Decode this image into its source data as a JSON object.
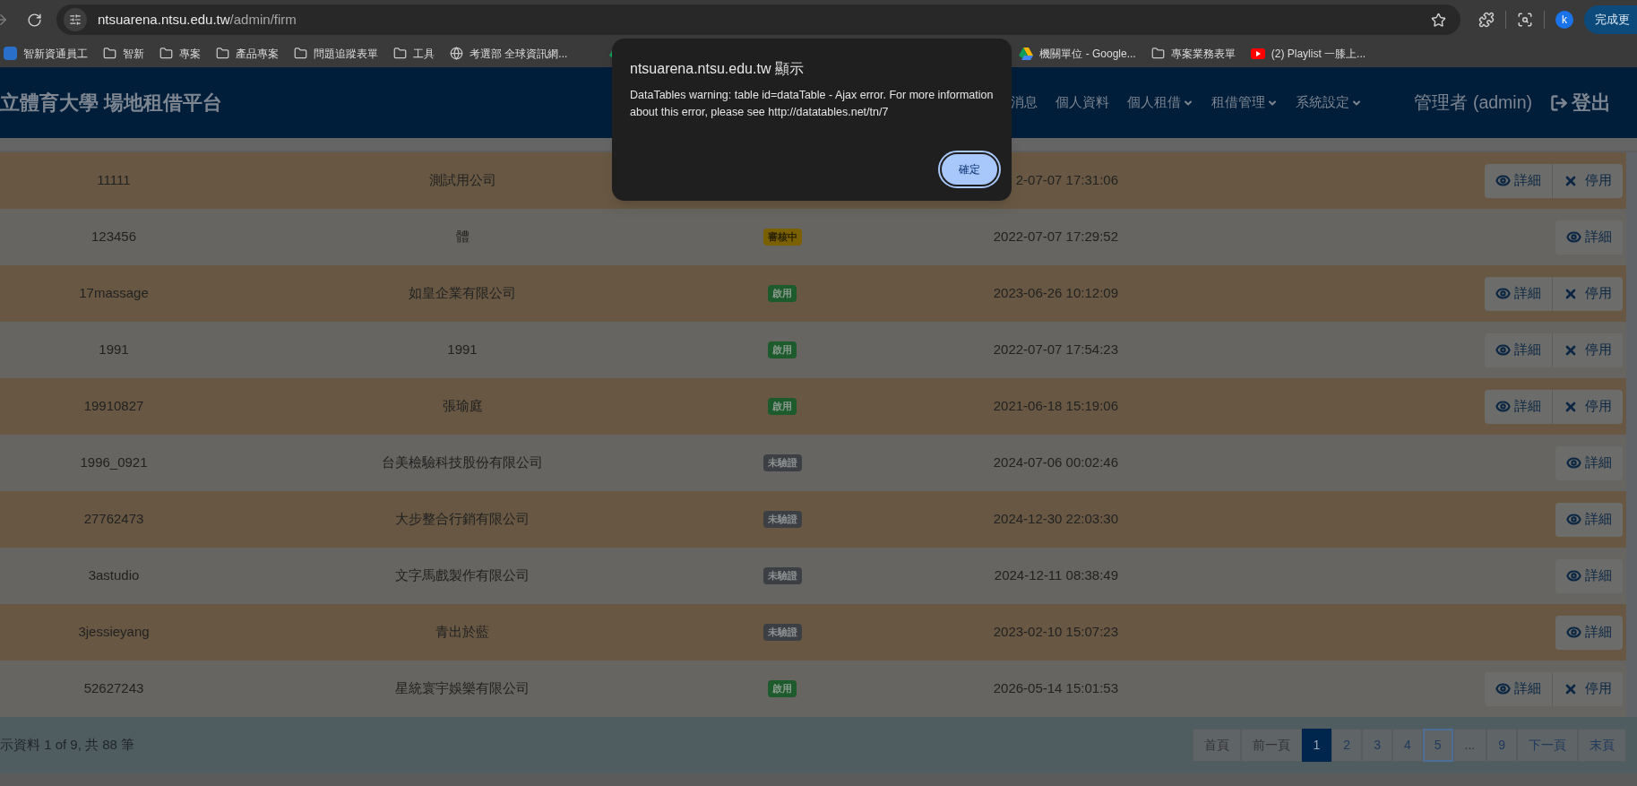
{
  "browser": {
    "url_host": "ntsuarena.ntsu.edu.tw",
    "url_path": "/admin/firm",
    "avatar": "k",
    "update_button": "完成更",
    "bookmarks": [
      {
        "kind": "logo",
        "label": "智新資通員工"
      },
      {
        "kind": "folder",
        "label": "智新"
      },
      {
        "kind": "folder",
        "label": "專案"
      },
      {
        "kind": "folder",
        "label": "產品專案"
      },
      {
        "kind": "folder",
        "label": "問題追蹤表單"
      },
      {
        "kind": "folder",
        "label": "工具"
      },
      {
        "kind": "globe",
        "label": "考選部 全球資訊網..."
      },
      {
        "kind": "drive"
      },
      {
        "kind": "drive",
        "label": "機關單位 - Google..."
      },
      {
        "kind": "folder",
        "label": "專案業務表單"
      },
      {
        "kind": "video",
        "label": "(2) Playlist 一膝上..."
      }
    ]
  },
  "navbar": {
    "title": "立體育大學 場地租借平台",
    "items": [
      {
        "label": "消息",
        "dropdown": false
      },
      {
        "label": "個人資料",
        "dropdown": false
      },
      {
        "label": "個人租借",
        "dropdown": true
      },
      {
        "label": "租借管理",
        "dropdown": true
      },
      {
        "label": "系統設定",
        "dropdown": true
      }
    ],
    "user": "管理者 (admin)",
    "logout": "登出"
  },
  "table": {
    "rows": [
      {
        "account": "11111",
        "name": "測試用公司",
        "date": "2-07-07 17:31:06",
        "actions": [
          {
            "kind": "view",
            "label": "詳細"
          },
          {
            "kind": "disable",
            "label": "停用"
          }
        ]
      },
      {
        "account": "123456",
        "name": "體",
        "status": {
          "kind": "pending",
          "label": "審核中"
        },
        "date": "2022-07-07 17:29:52",
        "actions": [
          {
            "kind": "view",
            "label": "詳細"
          }
        ]
      },
      {
        "account": "17massage",
        "name": "如皇企業有限公司",
        "status": {
          "kind": "active",
          "label": "啟用"
        },
        "date": "2023-06-26 10:12:09",
        "actions": [
          {
            "kind": "view",
            "label": "詳細"
          },
          {
            "kind": "disable",
            "label": "停用"
          }
        ]
      },
      {
        "account": "1991",
        "name": "1991",
        "status": {
          "kind": "active",
          "label": "啟用"
        },
        "date": "2022-07-07 17:54:23",
        "actions": [
          {
            "kind": "view",
            "label": "詳細"
          },
          {
            "kind": "disable",
            "label": "停用"
          }
        ]
      },
      {
        "account": "19910827",
        "name": "張瑜庭",
        "status": {
          "kind": "active",
          "label": "啟用"
        },
        "date": "2021-06-18 15:19:06",
        "actions": [
          {
            "kind": "view",
            "label": "詳細"
          },
          {
            "kind": "disable",
            "label": "停用"
          }
        ]
      },
      {
        "account": "1996_0921",
        "name": "台美檢驗科技股份有限公司",
        "status": {
          "kind": "unverified",
          "label": "未驗證"
        },
        "date": "2024-07-06 00:02:46",
        "actions": [
          {
            "kind": "view",
            "label": "詳細"
          }
        ]
      },
      {
        "account": "27762473",
        "name": "大步整合行銷有限公司",
        "status": {
          "kind": "unverified",
          "label": "未驗證"
        },
        "date": "2024-12-30 22:03:30",
        "actions": [
          {
            "kind": "view",
            "label": "詳細"
          }
        ]
      },
      {
        "account": "3astudio",
        "name": "文字馬戲製作有限公司",
        "status": {
          "kind": "unverified",
          "label": "未驗證"
        },
        "date": "2024-12-11 08:38:49",
        "actions": [
          {
            "kind": "view",
            "label": "詳細"
          }
        ]
      },
      {
        "account": "3jessieyang",
        "name": "青出於藍",
        "status": {
          "kind": "unverified",
          "label": "未驗證"
        },
        "date": "2023-02-10 15:07:23",
        "actions": [
          {
            "kind": "view",
            "label": "詳細"
          }
        ]
      },
      {
        "account": "52627243",
        "name": "星統寰宇娛樂有限公司",
        "status": {
          "kind": "active",
          "label": "啟用"
        },
        "date": "2026-05-14 15:01:53",
        "actions": [
          {
            "kind": "view",
            "label": "詳細"
          },
          {
            "kind": "disable",
            "label": "停用"
          }
        ]
      }
    ],
    "info": "示資料 1 of 9, 共 88 筆",
    "pagination": [
      {
        "label": "首頁",
        "selected": false,
        "disabled": true,
        "focused": false
      },
      {
        "label": "前一頁",
        "selected": false,
        "disabled": true,
        "focused": false
      },
      {
        "label": "1",
        "selected": true,
        "disabled": false,
        "focused": false
      },
      {
        "label": "2",
        "selected": false,
        "disabled": false,
        "focused": false
      },
      {
        "label": "3",
        "selected": false,
        "disabled": false,
        "focused": false
      },
      {
        "label": "4",
        "selected": false,
        "disabled": false,
        "focused": false
      },
      {
        "label": "5",
        "selected": false,
        "disabled": false,
        "focused": true
      },
      {
        "label": "...",
        "selected": false,
        "disabled": true,
        "focused": false
      },
      {
        "label": "9",
        "selected": false,
        "disabled": false,
        "focused": false
      },
      {
        "label": "下一頁",
        "selected": false,
        "disabled": false,
        "focused": false
      },
      {
        "label": "末頁",
        "selected": false,
        "disabled": false,
        "focused": false
      }
    ]
  },
  "dialog": {
    "title": "ntsuarena.ntsu.edu.tw 顯示",
    "message": "DataTables warning: table id=dataTable - Ajax error. For more information about this error, please see http://datatables.net/tn/7",
    "ok": "確定"
  }
}
